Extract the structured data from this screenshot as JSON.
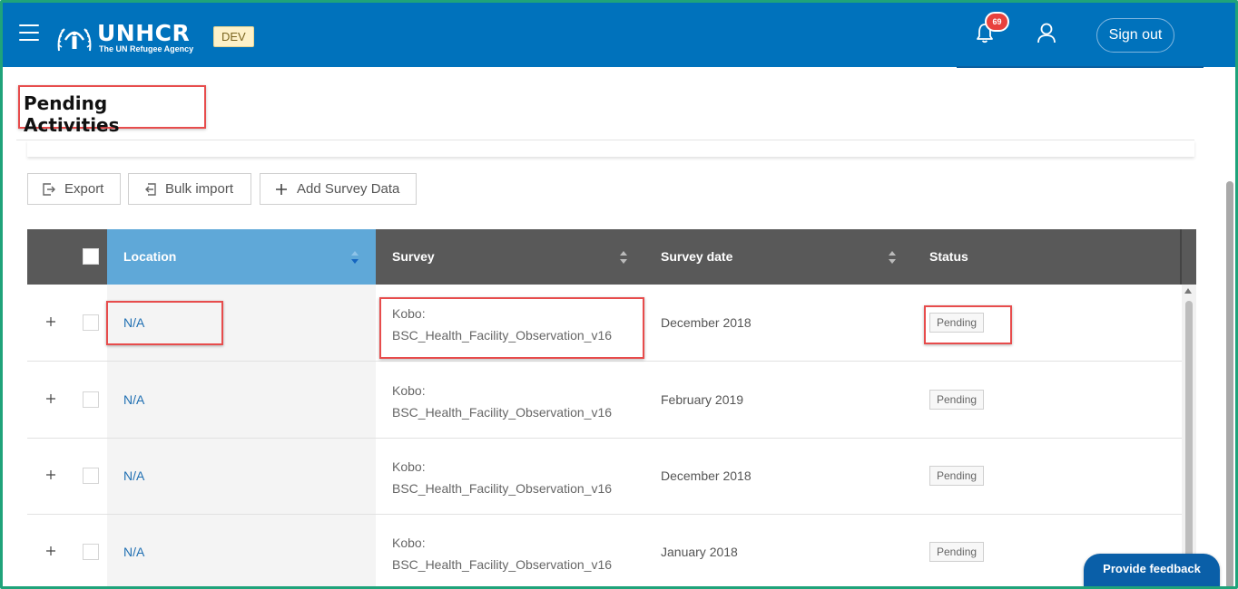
{
  "header": {
    "logo_name": "UNHCR",
    "logo_subtitle": "The UN Refugee Agency",
    "env_badge": "DEV",
    "notification_count": "69",
    "sign_out_label": "Sign out",
    "colors": {
      "bar": "#0072bc",
      "badge": "#e8413d"
    }
  },
  "page": {
    "title": "Pending Activities"
  },
  "toolbar": {
    "export_label": "Export",
    "bulk_import_label": "Bulk import",
    "add_survey_label": "Add Survey Data"
  },
  "table": {
    "columns": [
      "Location",
      "Survey",
      "Survey date",
      "Status"
    ],
    "rows": [
      {
        "location": "N/A",
        "survey_line1": "Kobo:",
        "survey_line2": "BSC_Health_Facility_Observation_v16",
        "date": "December 2018",
        "status": "Pending"
      },
      {
        "location": "N/A",
        "survey_line1": "Kobo:",
        "survey_line2": "BSC_Health_Facility_Observation_v16",
        "date": "February 2019",
        "status": "Pending"
      },
      {
        "location": "N/A",
        "survey_line1": "Kobo:",
        "survey_line2": "BSC_Health_Facility_Observation_v16",
        "date": "December 2018",
        "status": "Pending"
      },
      {
        "location": "N/A",
        "survey_line1": "Kobo:",
        "survey_line2": "BSC_Health_Facility_Observation_v16",
        "date": "January 2018",
        "status": "Pending"
      }
    ]
  },
  "feedback": {
    "label": "Provide feedback"
  }
}
